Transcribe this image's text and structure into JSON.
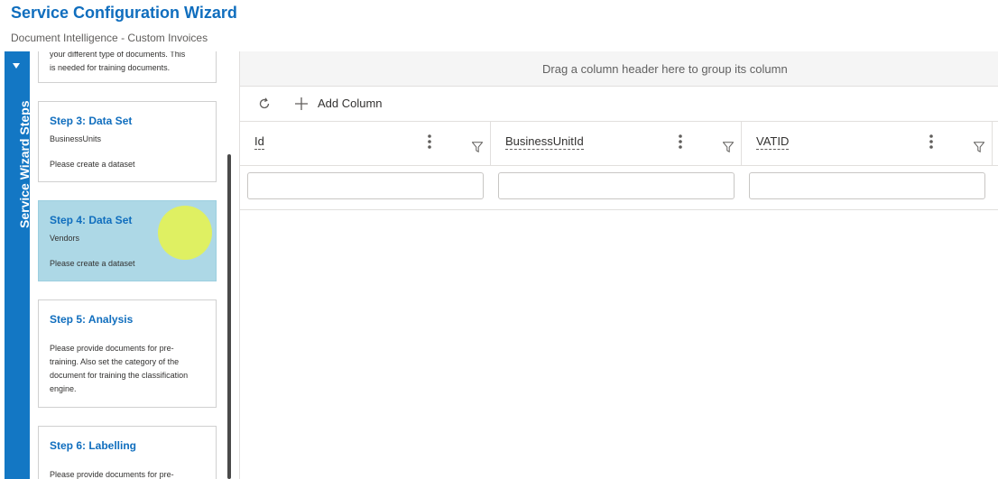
{
  "header": {
    "title": "Service Configuration Wizard",
    "subtitle": "Document Intelligence - Custom Invoices"
  },
  "rail": {
    "label": "Service Wizard Steps",
    "collapse_icon": "triangle-down-icon"
  },
  "steps": [
    {
      "title": "",
      "subtitle": "",
      "description": [
        "your different type of documents. This",
        "is needed for training documents."
      ],
      "active": false
    },
    {
      "title": "Step 3: Data Set",
      "subtitle": "BusinessUnits",
      "description": [
        "Please create a dataset"
      ],
      "active": false
    },
    {
      "title": "Step 4: Data Set",
      "subtitle": "Vendors",
      "description": [
        "Please create a dataset"
      ],
      "active": true
    },
    {
      "title": "Step 5: Analysis",
      "subtitle": "",
      "description": [
        "Please provide documents for pre-",
        "training. Also set the category of the",
        "document for training the classification",
        "engine."
      ],
      "active": false
    },
    {
      "title": "Step 6: Labelling",
      "subtitle": "",
      "description": [
        "Please provide documents for pre-"
      ],
      "active": false
    }
  ],
  "grid": {
    "group_panel_text": "Drag a column header here to group its column",
    "toolbar": {
      "refresh_icon": "refresh-icon",
      "add_icon": "plus-icon",
      "add_label": "Add Column"
    },
    "columns": [
      {
        "name": "Id",
        "menu_icon": "more-vertical-icon",
        "filter_icon": "filter-icon"
      },
      {
        "name": "BusinessUnitId",
        "menu_icon": "more-vertical-icon",
        "filter_icon": "filter-icon"
      },
      {
        "name": "VATID",
        "menu_icon": "more-vertical-icon",
        "filter_icon": "filter-icon"
      }
    ],
    "filter_values": [
      "",
      "",
      ""
    ]
  },
  "colors": {
    "brand_blue": "#106ebe",
    "rail_blue": "#1377c4",
    "active_step": "#add8e6",
    "cursor_highlight": "#e6f250"
  }
}
